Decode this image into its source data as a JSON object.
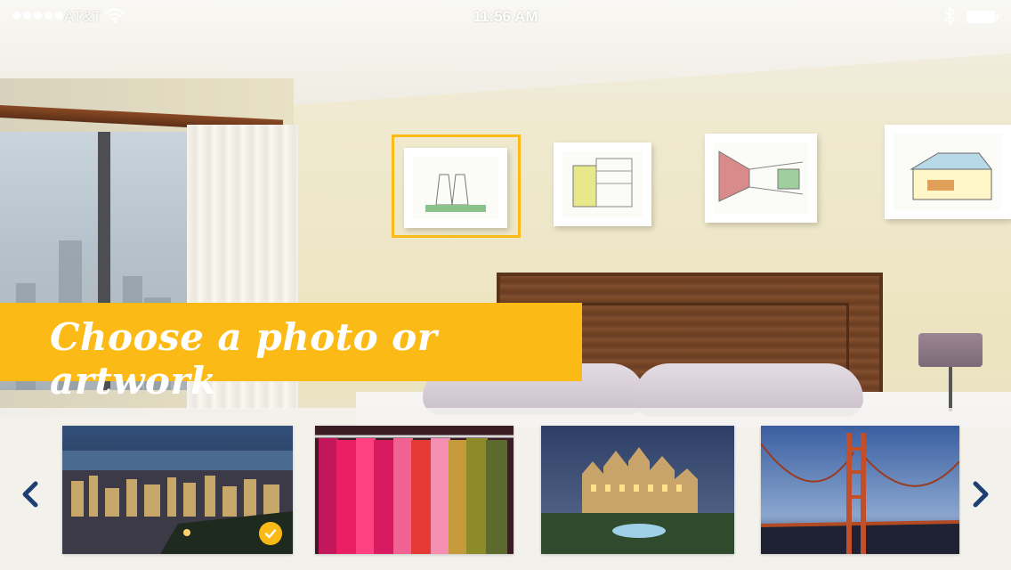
{
  "status_bar": {
    "carrier": "AT&T",
    "time": "11:56 AM"
  },
  "banner": {
    "title": "Choose a photo or artwork"
  },
  "colors": {
    "accent": "#fbba15",
    "arrow": "#1f3f73"
  },
  "carousel": {
    "items": [
      {
        "subject": "New York skyline at night",
        "selected": true
      },
      {
        "subject": "Colorful clothes on rack",
        "selected": false
      },
      {
        "subject": "Castle at dusk",
        "selected": false
      },
      {
        "subject": "Golden Gate Bridge",
        "selected": false
      }
    ]
  },
  "wall_art": [
    {
      "subject": "power plant sketch",
      "selected": true
    },
    {
      "subject": "building sketch",
      "selected": false
    },
    {
      "subject": "street perspective sketch",
      "selected": false
    },
    {
      "subject": "house sketch",
      "selected": false
    }
  ],
  "icons": [
    "wifi-icon",
    "bluetooth-icon",
    "battery-icon",
    "chevron-left-icon",
    "chevron-right-icon",
    "checkmark-icon"
  ]
}
